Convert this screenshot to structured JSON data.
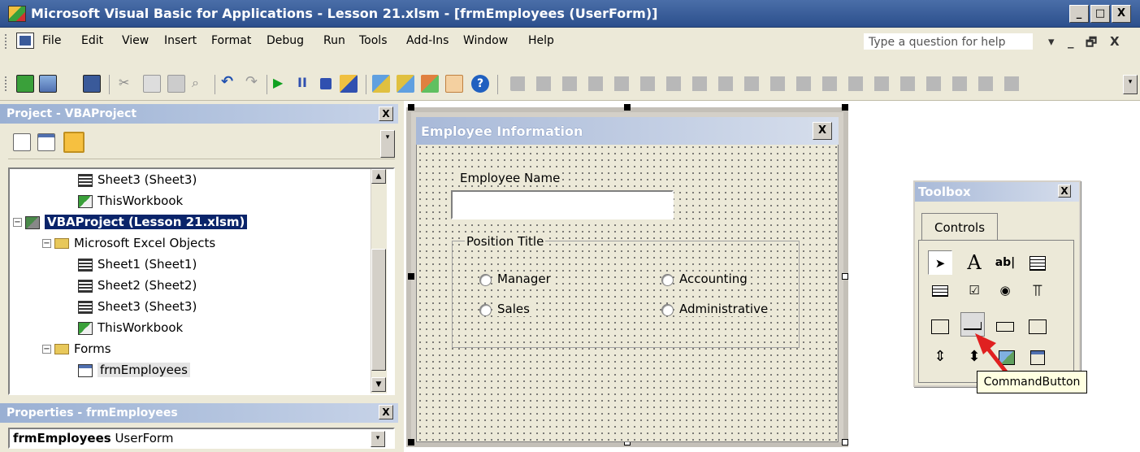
{
  "window": {
    "title": "Microsoft Visual Basic for Applications - Lesson 21.xlsm - [frmEmployees (UserForm)]",
    "controls": [
      "_",
      "□",
      "X"
    ]
  },
  "menubar": {
    "items": [
      "File",
      "Edit",
      "View",
      "Insert",
      "Format",
      "Debug",
      "Run",
      "Tools",
      "Add-Ins",
      "Window",
      "Help"
    ],
    "help_placeholder": "Type a question for help",
    "mdi_controls": [
      "▾",
      "_",
      "🗗",
      "X"
    ]
  },
  "project_panel": {
    "title": "Project - VBAProject",
    "close": "X",
    "tree": [
      {
        "label": "Sheet3 (Sheet3)",
        "icon": "sheet-icon"
      },
      {
        "label": "ThisWorkbook",
        "icon": "workbook-icon"
      },
      {
        "label": "VBAProject (Lesson 21.xlsm)",
        "icon": "project-icon",
        "selected": true
      },
      {
        "label": "Microsoft Excel Objects",
        "icon": "folder-icon"
      },
      {
        "label": "Sheet1 (Sheet1)",
        "icon": "sheet-icon"
      },
      {
        "label": "Sheet2 (Sheet2)",
        "icon": "sheet-icon"
      },
      {
        "label": "Sheet3 (Sheet3)",
        "icon": "sheet-icon"
      },
      {
        "label": "ThisWorkbook",
        "icon": "workbook-icon"
      },
      {
        "label": "Forms",
        "icon": "folder-icon"
      },
      {
        "label": "frmEmployees",
        "icon": "form-icon",
        "highlighted": true
      }
    ]
  },
  "properties_panel": {
    "title": "Properties - frmEmployees",
    "close": "X",
    "object_name": "frmEmployees",
    "object_type": "UserForm"
  },
  "userform": {
    "caption": "Employee Information",
    "close": "X",
    "name_label": "Employee Name",
    "name_value": "",
    "frame_caption": "Position Title",
    "options": [
      "Manager",
      "Accounting",
      "Sales",
      "Administrative"
    ]
  },
  "toolbox": {
    "title": "Toolbox",
    "close": "X",
    "tab": "Controls",
    "tooltip": "CommandButton",
    "tools": [
      "select-objects",
      "label",
      "textbox",
      "combobox",
      "listbox",
      "checkbox",
      "optionbutton",
      "togglebutton",
      "frame",
      "commandbutton",
      "tabstrip",
      "multipage",
      "scrollbar",
      "spinbutton",
      "image",
      "refedit"
    ],
    "glyphs": {
      "label": "A",
      "textbox": "ab|"
    }
  },
  "colors": {
    "titlebar": "#2c4f8c",
    "selection": "#0a246a",
    "arrow": "#e02020",
    "tooltip": "#ffffe1"
  }
}
